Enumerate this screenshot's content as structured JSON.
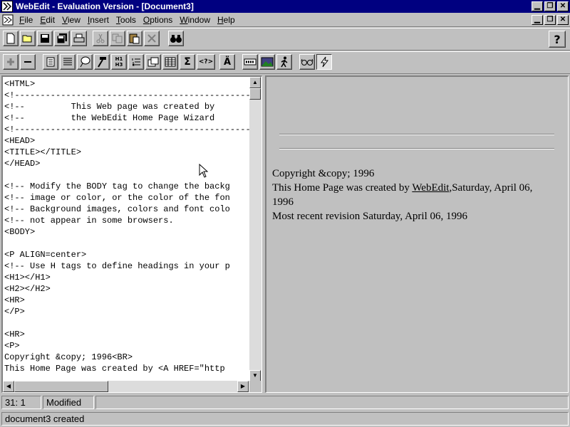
{
  "window": {
    "title": "WebEdit - Evaluation Version - [Document3]"
  },
  "menu": {
    "items": [
      {
        "label": "File",
        "key": "F",
        "rest": "ile"
      },
      {
        "label": "Edit",
        "key": "E",
        "rest": "dit"
      },
      {
        "label": "View",
        "key": "V",
        "rest": "iew"
      },
      {
        "label": "Insert",
        "key": "I",
        "rest": "nsert"
      },
      {
        "label": "Tools",
        "key": "T",
        "rest": "ools"
      },
      {
        "label": "Options",
        "key": "O",
        "rest": "ptions"
      },
      {
        "label": "Window",
        "key": "W",
        "rest": "indow"
      },
      {
        "label": "Help",
        "key": "H",
        "rest": "elp"
      }
    ]
  },
  "toolbar1": {
    "buttons": [
      "new-file-icon",
      "open-folder-icon",
      "save-icon",
      "save-all-icon",
      "print-icon",
      "cut-icon",
      "copy-icon",
      "paste-icon",
      "delete-icon",
      "find-binoculars-icon"
    ],
    "help_label": "?"
  },
  "toolbar2": {
    "sigma": "Σ",
    "query_tag": "<?>",
    "umlaut": "Ä",
    "h_tag_top": "H1",
    "h_tag_bottom": "H3"
  },
  "editor": {
    "lines": [
      "<HTML>",
      "<!------------------------------------------------------------",
      "<!--         This Web page was created by",
      "<!--         the WebEdit Home Page Wizard",
      "<!------------------------------------------------------------",
      "<HEAD>",
      "<TITLE></TITLE>",
      "</HEAD>",
      "",
      "<!-- Modify the BODY tag to change the backg",
      "<!-- image or color, or the color of the fon",
      "<!-- Background images, colors and font colo",
      "<!-- not appear in some browsers.",
      "<BODY>",
      "",
      "<P ALIGN=center>",
      "<!-- Use H tags to define headings in your p",
      "<H1></H1>",
      "<H2></H2>",
      "<HR>",
      "</P>",
      "",
      "<HR>",
      "<P>",
      "Copyright &copy; 1996<BR>",
      "This Home Page was created by <A HREF=\"http"
    ]
  },
  "preview": {
    "copyright": "Copyright &copy; 1996",
    "created_prefix": "This Home Page was created by ",
    "created_link": "WebEdit",
    "created_suffix": ",Saturday, April 06,",
    "created_year": "1996",
    "revision": "Most recent revision Saturday, April 06, 1996"
  },
  "status": {
    "position": "31: 1",
    "state": "Modified",
    "message": "document3 created"
  },
  "colors": {
    "titlebar": "#000080",
    "face": "#c0c0c0"
  }
}
